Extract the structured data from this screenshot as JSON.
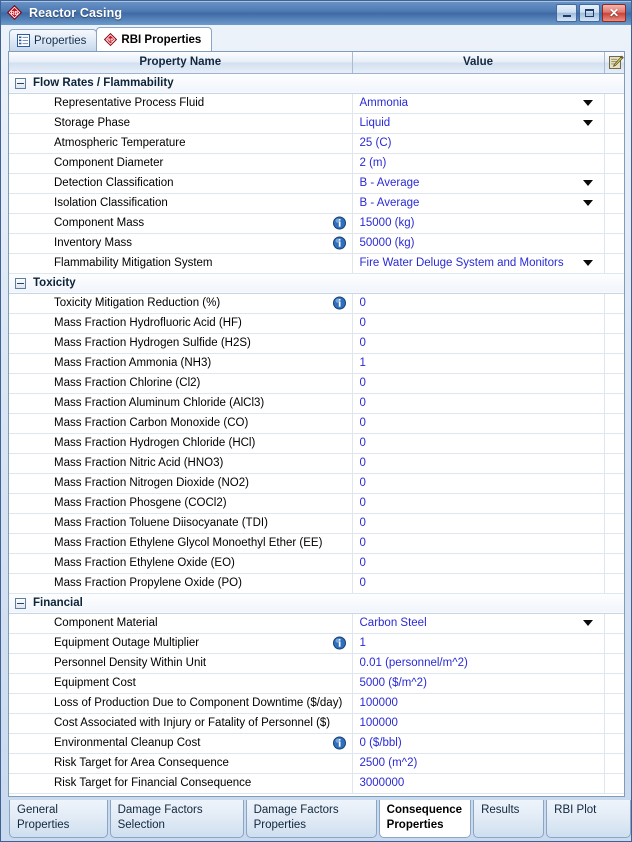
{
  "window": {
    "title": "Reactor Casing",
    "icon": "rb-diamond-icon",
    "minimize_label": "",
    "maximize_label": "",
    "close_label": "✕"
  },
  "top_tabs": [
    {
      "label": "Properties",
      "icon": "list-properties-icon",
      "active": false
    },
    {
      "label": "RBI Properties",
      "icon": "rb-diamond-icon",
      "active": true
    }
  ],
  "grid": {
    "columns": [
      "Property Name",
      "Value",
      ""
    ],
    "edit_icon": "notepad-pencil-icon",
    "rows": [
      {
        "kind": "group",
        "name": "Flow Rates / Flammability"
      },
      {
        "kind": "prop",
        "name": "Representative Process Fluid",
        "value": "Ammonia",
        "dropdown": true,
        "info": false
      },
      {
        "kind": "prop",
        "name": "Storage Phase",
        "value": "Liquid",
        "dropdown": true,
        "info": false
      },
      {
        "kind": "prop",
        "name": "Atmospheric Temperature",
        "value": "25 (C)",
        "dropdown": false,
        "info": false
      },
      {
        "kind": "prop",
        "name": "Component Diameter",
        "value": "2 (m)",
        "dropdown": false,
        "info": false
      },
      {
        "kind": "prop",
        "name": "Detection Classification",
        "value": "B - Average",
        "dropdown": true,
        "info": false
      },
      {
        "kind": "prop",
        "name": "Isolation Classification",
        "value": "B - Average",
        "dropdown": true,
        "info": false
      },
      {
        "kind": "prop",
        "name": "Component Mass",
        "value": "15000 (kg)",
        "dropdown": false,
        "info": true
      },
      {
        "kind": "prop",
        "name": "Inventory Mass",
        "value": "50000 (kg)",
        "dropdown": false,
        "info": true
      },
      {
        "kind": "prop",
        "name": "Flammability Mitigation System",
        "value": "Fire Water Deluge System and Monitors",
        "dropdown": true,
        "info": false
      },
      {
        "kind": "group",
        "name": "Toxicity"
      },
      {
        "kind": "prop",
        "name": "Toxicity Mitigation Reduction (%)",
        "value": "0",
        "dropdown": false,
        "info": true
      },
      {
        "kind": "prop",
        "name": "Mass Fraction Hydrofluoric Acid (HF)",
        "value": "0",
        "dropdown": false,
        "info": false
      },
      {
        "kind": "prop",
        "name": "Mass Fraction Hydrogen Sulfide (H2S)",
        "value": "0",
        "dropdown": false,
        "info": false
      },
      {
        "kind": "prop",
        "name": "Mass Fraction Ammonia (NH3)",
        "value": "1",
        "dropdown": false,
        "info": false
      },
      {
        "kind": "prop",
        "name": "Mass Fraction Chlorine (Cl2)",
        "value": "0",
        "dropdown": false,
        "info": false
      },
      {
        "kind": "prop",
        "name": "Mass Fraction Aluminum Chloride (AlCl3)",
        "value": "0",
        "dropdown": false,
        "info": false
      },
      {
        "kind": "prop",
        "name": "Mass Fraction Carbon Monoxide (CO)",
        "value": "0",
        "dropdown": false,
        "info": false
      },
      {
        "kind": "prop",
        "name": "Mass Fraction Hydrogen Chloride (HCl)",
        "value": "0",
        "dropdown": false,
        "info": false
      },
      {
        "kind": "prop",
        "name": "Mass Fraction Nitric Acid (HNO3)",
        "value": "0",
        "dropdown": false,
        "info": false
      },
      {
        "kind": "prop",
        "name": "Mass Fraction Nitrogen Dioxide (NO2)",
        "value": "0",
        "dropdown": false,
        "info": false
      },
      {
        "kind": "prop",
        "name": "Mass Fraction Phosgene (COCl2)",
        "value": "0",
        "dropdown": false,
        "info": false
      },
      {
        "kind": "prop",
        "name": "Mass Fraction Toluene Diisocyanate (TDI)",
        "value": "0",
        "dropdown": false,
        "info": false
      },
      {
        "kind": "prop",
        "name": "Mass Fraction Ethylene Glycol Monoethyl Ether (EE)",
        "value": "0",
        "dropdown": false,
        "info": false
      },
      {
        "kind": "prop",
        "name": "Mass Fraction Ethylene Oxide (EO)",
        "value": "0",
        "dropdown": false,
        "info": false
      },
      {
        "kind": "prop",
        "name": "Mass Fraction Propylene Oxide (PO)",
        "value": "0",
        "dropdown": false,
        "info": false
      },
      {
        "kind": "group",
        "name": "Financial"
      },
      {
        "kind": "prop",
        "name": "Component Material",
        "value": "Carbon Steel",
        "dropdown": true,
        "info": false
      },
      {
        "kind": "prop",
        "name": "Equipment Outage Multiplier",
        "value": "1",
        "dropdown": false,
        "info": true
      },
      {
        "kind": "prop",
        "name": "Personnel Density Within Unit",
        "value": "0.01 (personnel/m^2)",
        "dropdown": false,
        "info": false
      },
      {
        "kind": "prop",
        "name": "Equipment Cost",
        "value": "5000 ($/m^2)",
        "dropdown": false,
        "info": false
      },
      {
        "kind": "prop",
        "name": "Loss of Production Due to Component Downtime ($/day)",
        "value": "100000",
        "dropdown": false,
        "info": false
      },
      {
        "kind": "prop",
        "name": "Cost Associated with Injury or Fatality of Personnel ($)",
        "value": "100000",
        "dropdown": false,
        "info": false
      },
      {
        "kind": "prop",
        "name": "Environmental Cleanup Cost",
        "value": "0 ($/bbl)",
        "dropdown": false,
        "info": true
      },
      {
        "kind": "prop",
        "name": "Risk Target for Area Consequence",
        "value": "2500 (m^2)",
        "dropdown": false,
        "info": false
      },
      {
        "kind": "prop",
        "name": "Risk Target for Financial Consequence",
        "value": "3000000",
        "dropdown": false,
        "info": false
      }
    ]
  },
  "bottom_tabs": [
    {
      "label": "General\nProperties",
      "active": false,
      "w": "w1"
    },
    {
      "label": "Damage Factors\nSelection",
      "active": false,
      "w": "w2"
    },
    {
      "label": "Damage Factors\nProperties",
      "active": false,
      "w": "w3"
    },
    {
      "label": "Consequence\nProperties",
      "active": true,
      "w": "w4"
    },
    {
      "label": "Results",
      "active": false,
      "w": "w5"
    },
    {
      "label": "RBI Plot",
      "active": false,
      "w": "w6"
    }
  ],
  "colors": {
    "value_text": "#2a2ad6",
    "titlebar_accent": "#4e7bb4",
    "brand_red": "#cc1122",
    "info_blue": "#2f6fc0"
  }
}
